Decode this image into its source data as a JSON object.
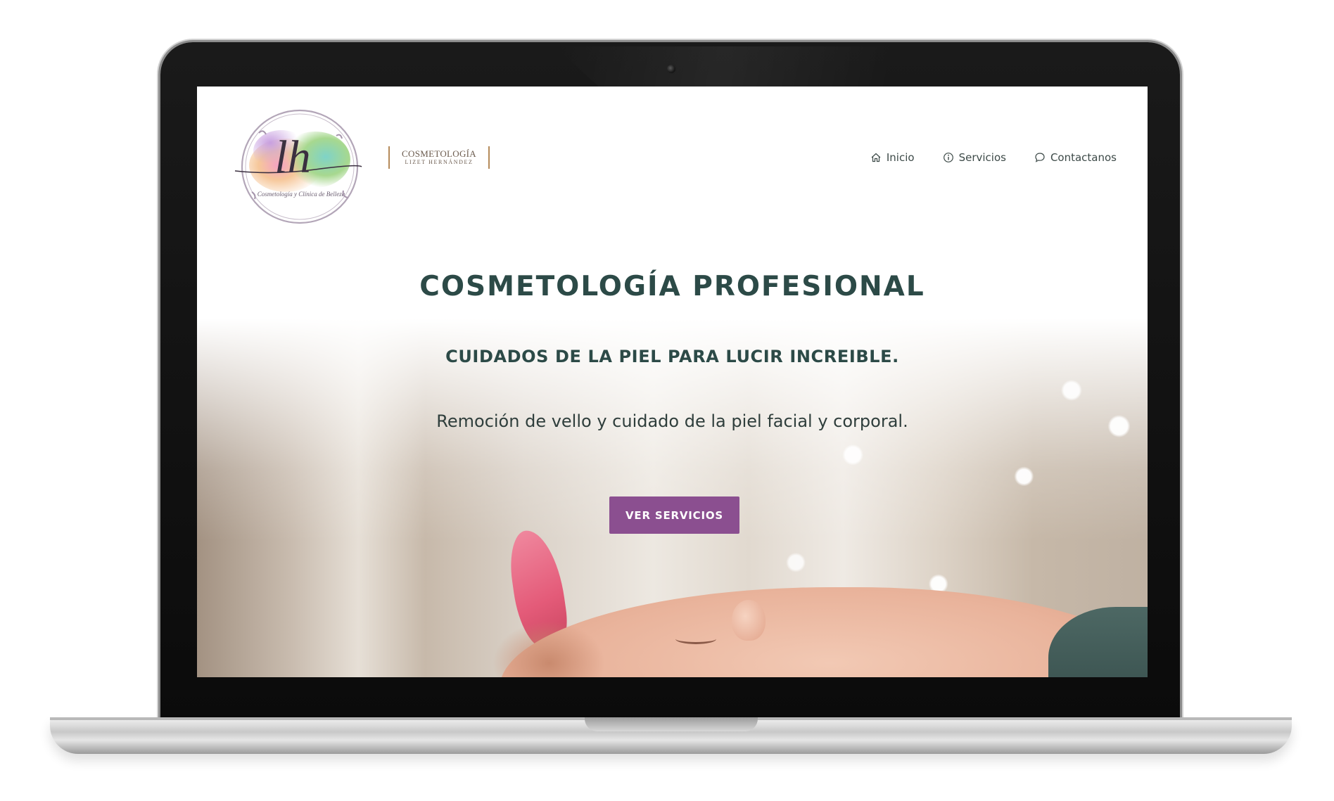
{
  "brand": {
    "logo_monogram": "lh",
    "logo_script": "Cosmetología y Clínica de Belleza",
    "wordmark_line1": "COSMETOLOGÍA",
    "wordmark_line2": "LIZET HERNÁNDEZ"
  },
  "nav": {
    "items": [
      {
        "label": "Inicio",
        "icon": "home-icon"
      },
      {
        "label": "Servicios",
        "icon": "info-icon"
      },
      {
        "label": "Contactanos",
        "icon": "chat-bubble-icon"
      }
    ]
  },
  "hero": {
    "title": "COSMETOLOGÍA PROFESIONAL",
    "subtitle": "CUIDADOS DE LA PIEL PARA LUCIR INCREIBLE.",
    "lead": "Remoción de vello y cuidado de la piel facial y corporal.",
    "cta_label": "VER SERVICIOS"
  },
  "colors": {
    "heading": "#2c4a47",
    "cta": "#8b4f90",
    "wordmark_frame": "#b58a5a"
  }
}
